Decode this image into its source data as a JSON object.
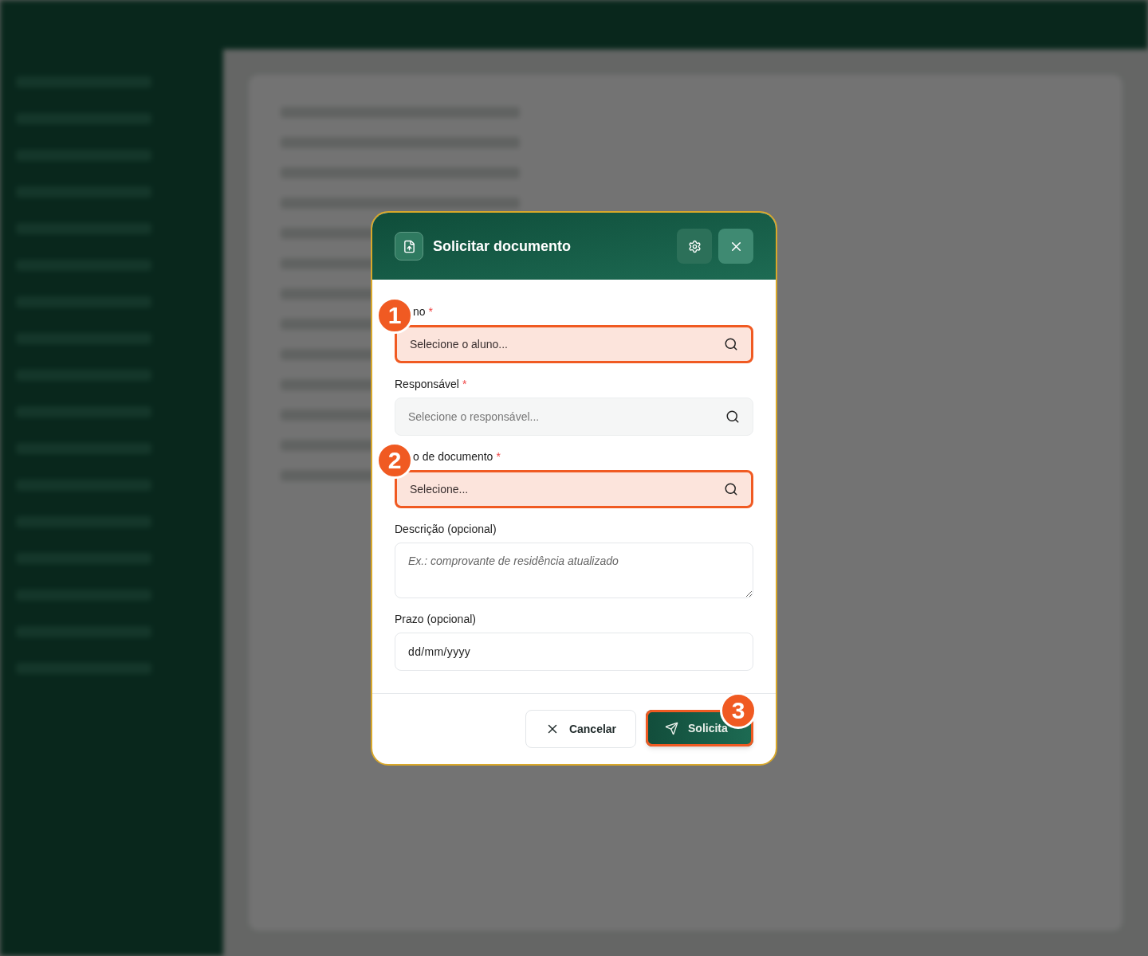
{
  "dialog": {
    "title": "Solicitar documento",
    "fields": [
      {
        "kind": "search",
        "label": "no",
        "required_mark": "*",
        "placeholder": "Selecione o aluno...",
        "highlighted": true,
        "marker": "1"
      },
      {
        "kind": "search",
        "label": "Responsável",
        "required_mark": "*",
        "placeholder": "Selecione o responsável...",
        "highlighted": false
      },
      {
        "kind": "search",
        "label": "o de documento",
        "required_mark": "*",
        "placeholder": "Selecione...",
        "highlighted": true,
        "marker": "2"
      },
      {
        "kind": "textarea",
        "label": "Descrição (opcional)",
        "placeholder": "Ex.: comprovante de residência atualizado",
        "highlighted": false
      },
      {
        "kind": "date",
        "label": "Prazo (opcional)",
        "placeholder": "dd/mm/yyyy",
        "highlighted": false
      }
    ],
    "buttons": [
      {
        "kind": "cancel",
        "label": "Cancelar",
        "highlighted": false
      },
      {
        "kind": "submit",
        "label": "Solicita",
        "highlighted": true,
        "marker": "3"
      }
    ]
  }
}
